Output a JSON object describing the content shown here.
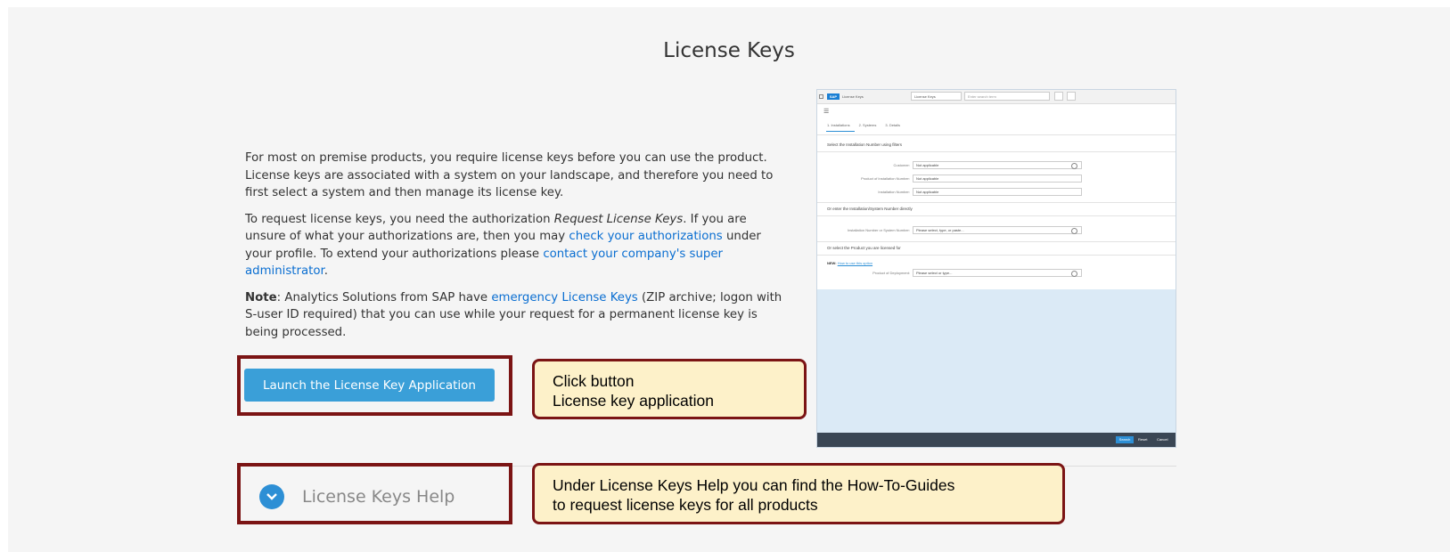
{
  "page": {
    "title": "License Keys"
  },
  "intro": {
    "para1": "For most on premise products, you require license keys before you can use the product. License keys are associated with a system on your landscape, and therefore you need to first select a system and then manage its license key.",
    "para2_a": "To request license keys, you need the authorization ",
    "para2_em": "Request License Keys",
    "para2_b": ". If you are unsure of what your authorizations are, then you may ",
    "para2_link1": "check your authorizations",
    "para2_c": " under your profile. To extend your authorizations please ",
    "para2_link2": "contact your company's super administrator",
    "para2_d": ".",
    "note_label": "Note",
    "note_a": ": Analytics Solutions from SAP have ",
    "note_link": "emergency License Keys",
    "note_b": " (ZIP archive; logon with S-user ID required) that you can use while your request for a permanent license key is being processed."
  },
  "launch_button": {
    "label": "Launch the License Key Application"
  },
  "callouts": {
    "button_line1": "Click button",
    "button_line2": "License key application",
    "help_line1": "Under License Keys Help you can find the How-To-Guides",
    "help_line2": "to request license keys for all products"
  },
  "help_section": {
    "label": "License Keys Help",
    "icon": "chevron-down-icon"
  },
  "preview": {
    "logo": "SAP",
    "brand": "License Keys",
    "dropdown": "License Keys",
    "search_placeholder": "Enter search term",
    "tabs": [
      "1. Installations",
      "2. Systems",
      "3. Details"
    ],
    "section1": "Select the Installation Number using filters",
    "fields1": [
      {
        "label": "Customer:",
        "value": "Not applicable"
      },
      {
        "label": "Product of Installation Number:",
        "value": "Not applicable"
      },
      {
        "label": "Installation Number:",
        "value": "Not applicable"
      }
    ],
    "section2": "Or enter the Installation/System Number directly",
    "field2": {
      "label": "Installation Number or System Number:",
      "value": "Please select, type, or paste..."
    },
    "section3": "Or select the Product you are licensed for",
    "new_label": "NEW:",
    "new_link": "How to use this option",
    "field3": {
      "label": "Product of Deployment:",
      "value": "Please select or type..."
    },
    "footer_buttons": [
      "Search",
      "Reset",
      "Cancel"
    ],
    "accent": "#2d8fd5"
  },
  "colors": {
    "highlight_border": "#7b1414",
    "callout_bg": "#fdf1c9",
    "button_bg": "#3a9fd8",
    "link": "#0a6ed1"
  }
}
